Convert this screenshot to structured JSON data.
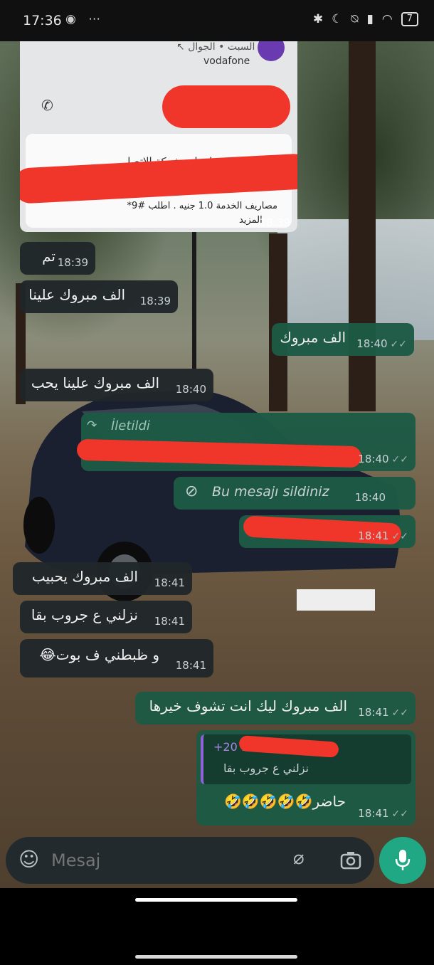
{
  "status_bar": {
    "time": "17:36",
    "left_icons": "◉ ⋯",
    "battery": "7"
  },
  "shared_screenshot": {
    "operator_line": "↖ السبت • الجوال",
    "operator": "vodafone",
    "card_title": "معلومات شركة الاتصا",
    "card_text": "مصاريف الخدمة 1.0 جنيه . اطلب #9*",
    "card_footer": "المزيد",
    "time": "18:39"
  },
  "messages": [
    {
      "id": "m1",
      "dir": "in",
      "text": "تم",
      "time": "18:39"
    },
    {
      "id": "m2",
      "dir": "in",
      "text": "الف مبروك علينا",
      "time": "18:39"
    },
    {
      "id": "m3",
      "dir": "out",
      "text": "الف مبروك",
      "time": "18:40"
    },
    {
      "id": "m4",
      "dir": "in",
      "text": "الف مبروك علينا يحب",
      "time": "18:40"
    },
    {
      "id": "m5",
      "dir": "out",
      "forwarded_label": "İletildi",
      "text": "",
      "time": "18:40"
    },
    {
      "id": "m6",
      "dir": "out",
      "deleted_text": "Bu mesajı sildiniz",
      "time": "18:40"
    },
    {
      "id": "m7",
      "dir": "out",
      "text": "",
      "time": "18:41"
    },
    {
      "id": "m8",
      "dir": "in",
      "text": "الف مبروك يحبيب",
      "time": "18:41"
    },
    {
      "id": "m9",
      "dir": "in",
      "text": "نزلني ع جروب بقا",
      "time": "18:41"
    },
    {
      "id": "m10",
      "dir": "in",
      "text": "و ظبطني ف بوت😂",
      "time": "18:41"
    },
    {
      "id": "m11",
      "dir": "out",
      "text": "الف مبروك ليك انت تشوف خيرها",
      "time": "18:41"
    },
    {
      "id": "m12",
      "dir": "out",
      "quote_sender": "+20 12",
      "quote_text": "نزلني ع جروب بقا",
      "text": "حاضر🤣🤣🤣🤣🤣",
      "time": "18:41"
    }
  ],
  "input": {
    "placeholder": "Mesaj"
  },
  "icons": {
    "emoji": "emoji-icon",
    "attach": "paperclip-icon",
    "camera": "camera-icon",
    "mic": "microphone-icon",
    "forward": "forward-arrow-icon",
    "deleted": "blocked-icon",
    "read": "double-check-icon"
  },
  "colors": {
    "incoming": "#242a2e",
    "outgoing": "#1d5a45",
    "mic": "#20a884",
    "redaction": "#f0362b"
  }
}
